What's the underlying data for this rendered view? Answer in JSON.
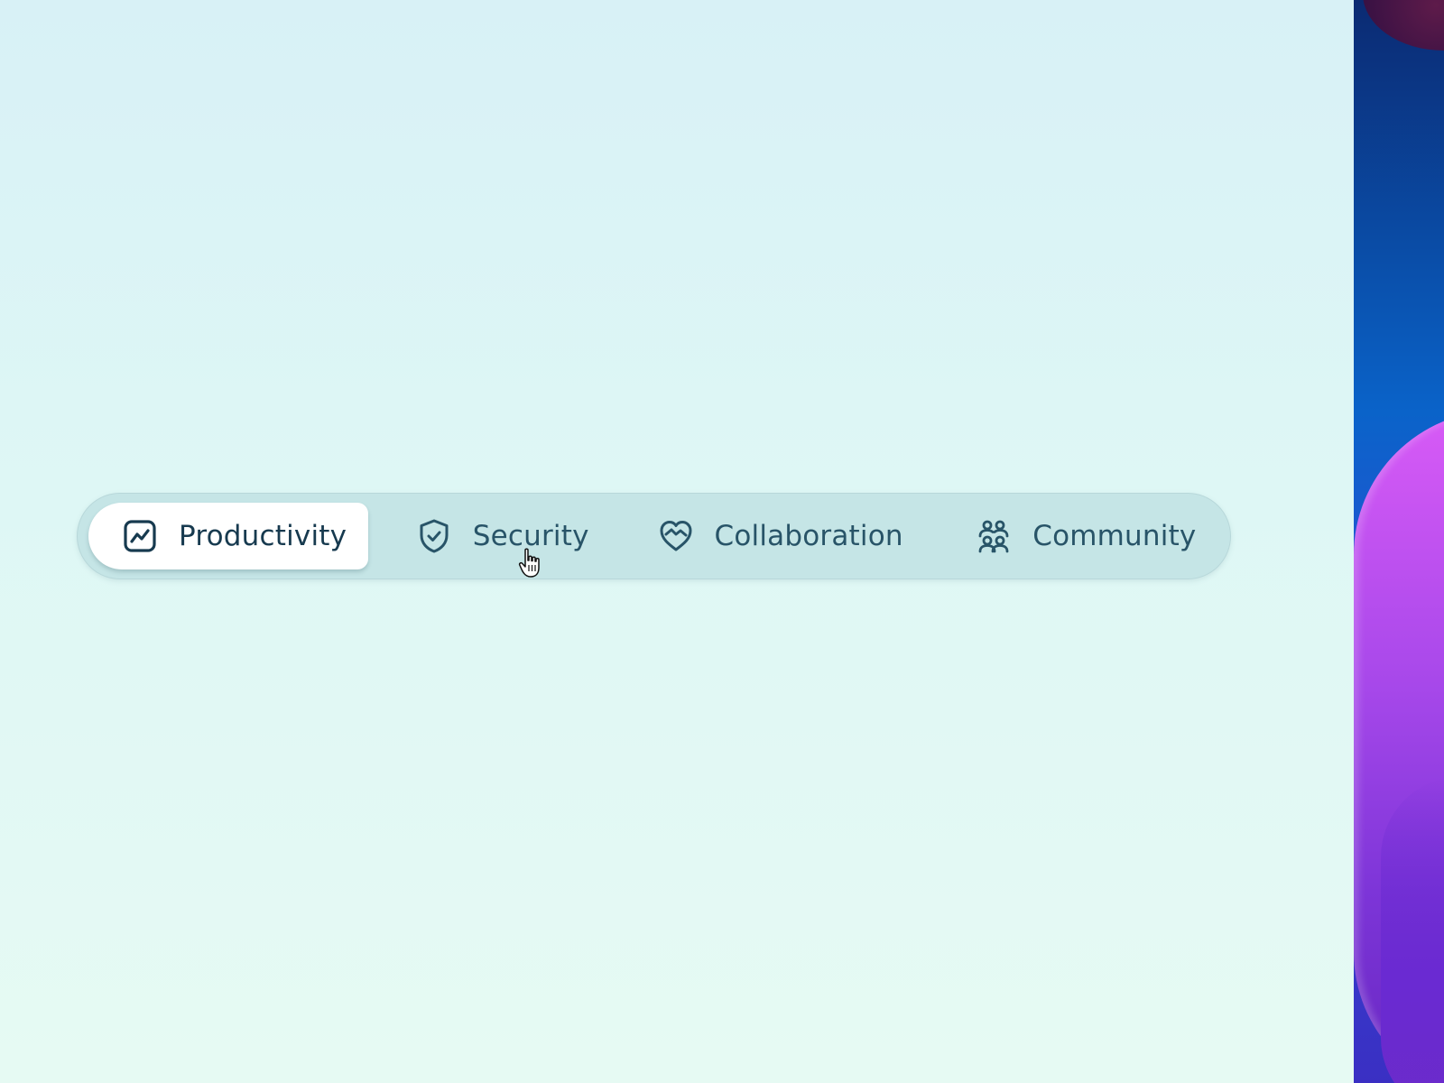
{
  "tabs": [
    {
      "id": "productivity",
      "label": "Productivity",
      "icon": "chart-line-icon",
      "active": true
    },
    {
      "id": "security",
      "label": "Security",
      "icon": "shield-check-icon",
      "active": false
    },
    {
      "id": "collaboration",
      "label": "Collaboration",
      "icon": "heart-handshake-icon",
      "active": false
    },
    {
      "id": "community",
      "label": "Community",
      "icon": "users-group-icon",
      "active": false
    }
  ],
  "colors": {
    "text": "#285468",
    "active_text": "#173a4f",
    "tabbar_bg": "#c5e5e6",
    "active_tab_bg": "#ffffff"
  }
}
